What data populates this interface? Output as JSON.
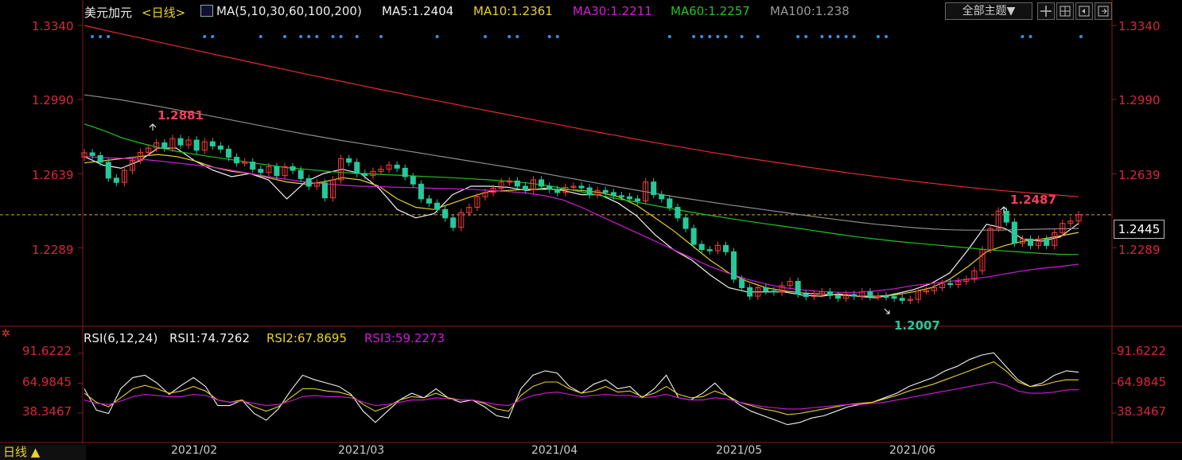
{
  "header": {
    "title": "美元加元",
    "period": "<日线>",
    "ma_label": "MA(5,10,30,60,100,200)",
    "ma5": "MA5:1.2404",
    "ma10": "MA10:1.2361",
    "ma30": "MA30:1.2211",
    "ma60": "MA60:1.2257",
    "ma100": "MA100:1.238",
    "theme_button": "全部主题▼"
  },
  "rsi_header": {
    "label": "RSI(6,12,24)",
    "rsi1": "RSI1:74.7262",
    "rsi2": "RSI2:67.8695",
    "rsi3": "RSI3:59.2273"
  },
  "bottom_bar": {
    "period_button": "日线 ▲"
  },
  "colors": {
    "up": "#ff3b3b",
    "down": "#27c99a",
    "ma5": "#f2f2f2",
    "ma10": "#e8d22a",
    "ma30": "#d21bd8",
    "ma60": "#21c421",
    "ma100": "#8c8c8c",
    "ma200": "#e62b2b",
    "rsi1": "#f2f2f2",
    "rsi2": "#e8d22a",
    "rsi3": "#d21bd8",
    "axis": "#d7263d"
  },
  "chart_data": [
    {
      "type": "candlestick",
      "title": "美元加元",
      "y_ticks": [
        "1.3340",
        "1.2990",
        "1.2639",
        "1.2289"
      ],
      "x_ticks": [
        "2021/02",
        "2021/03",
        "2021/04",
        "2021/05",
        "2021/06"
      ],
      "ylim": [
        1.1925,
        1.334
      ],
      "current_price": "1.2445",
      "annotations": {
        "high": "1.2881",
        "low": "1.2007",
        "recent_high": "1.2487"
      },
      "ohlc_close": [
        1.2738,
        1.2725,
        1.2693,
        1.2618,
        1.2598,
        1.2655,
        1.2702,
        1.274,
        1.276,
        1.2785,
        1.276,
        1.2805,
        1.2775,
        1.2798,
        1.275,
        1.279,
        1.277,
        1.2755,
        1.2717,
        1.269,
        1.2694,
        1.266,
        1.2645,
        1.2672,
        1.263,
        1.2672,
        1.2655,
        1.2616,
        1.258,
        1.2595,
        1.2525,
        1.261,
        1.271,
        1.2693,
        1.264,
        1.263,
        1.265,
        1.266,
        1.268,
        1.2665,
        1.2625,
        1.259,
        1.252,
        1.25,
        1.247,
        1.243,
        1.2385,
        1.2455,
        1.248,
        1.253,
        1.255,
        1.257,
        1.26,
        1.2605,
        1.258,
        1.2563,
        1.261,
        1.258,
        1.2565,
        1.255,
        1.2575,
        1.258,
        1.2572,
        1.254,
        1.256,
        1.255,
        1.2535,
        1.253,
        1.252,
        1.251,
        1.26,
        1.254,
        1.252,
        1.248,
        1.243,
        1.238,
        1.2305,
        1.228,
        1.2275,
        1.23,
        1.227,
        1.214,
        1.21,
        1.206,
        1.21,
        1.2085,
        1.208,
        1.211,
        1.213,
        1.207,
        1.2058,
        1.207,
        1.208,
        1.2063,
        1.205,
        1.2068,
        1.206,
        1.208,
        1.2058,
        1.206,
        1.2058,
        1.205,
        1.204,
        1.2045,
        1.2085,
        1.2086,
        1.21,
        1.212,
        1.2115,
        1.213,
        1.214,
        1.218,
        1.228,
        1.238,
        1.2462,
        1.241,
        1.231,
        1.233,
        1.23,
        1.233,
        1.23,
        1.236,
        1.2404,
        1.2415,
        1.2445
      ],
      "series": [
        {
          "name": "MA5",
          "values": [
            1.272,
            1.268,
            1.2665,
            1.27,
            1.276,
            1.276,
            1.27,
            1.2655,
            1.2625,
            1.264,
            1.261,
            1.252,
            1.26,
            1.264,
            1.266,
            1.264,
            1.257,
            1.247,
            1.243,
            1.245,
            1.254,
            1.258,
            1.258,
            1.2575,
            1.256,
            1.257,
            1.256,
            1.254,
            1.254,
            1.25,
            1.244,
            1.235,
            1.228,
            1.223,
            1.216,
            1.21,
            1.208,
            1.208,
            1.208,
            1.2065,
            1.206,
            1.207,
            1.206,
            1.2052,
            1.207,
            1.209,
            1.212,
            1.217,
            1.228,
            1.24,
            1.238,
            1.233,
            1.232,
            1.234,
            1.2404
          ]
        },
        {
          "name": "MA10",
          "values": [
            1.269,
            1.27,
            1.271,
            1.272,
            1.273,
            1.272,
            1.27,
            1.267,
            1.265,
            1.264,
            1.262,
            1.26,
            1.259,
            1.26,
            1.262,
            1.261,
            1.258,
            1.252,
            1.248,
            1.247,
            1.25,
            1.253,
            1.2555,
            1.256,
            1.2565,
            1.2565,
            1.2565,
            1.256,
            1.255,
            1.253,
            1.249,
            1.243,
            1.237,
            1.23,
            1.223,
            1.217,
            1.213,
            1.21,
            1.2085,
            1.2075,
            1.207,
            1.2065,
            1.206,
            1.206,
            1.2065,
            1.208,
            1.21,
            1.214,
            1.22,
            1.227,
            1.23,
            1.232,
            1.233,
            1.2345,
            1.2361
          ]
        },
        {
          "name": "MA30",
          "values": [
            1.272,
            1.2715,
            1.2712,
            1.2708,
            1.27,
            1.269,
            1.268,
            1.267,
            1.2655,
            1.264,
            1.2625,
            1.2612,
            1.26,
            1.2592,
            1.2585,
            1.258,
            1.2578,
            1.2575,
            1.2573,
            1.257,
            1.2568,
            1.2565,
            1.256,
            1.2555,
            1.2548,
            1.2535,
            1.2515,
            1.248,
            1.244,
            1.24,
            1.236,
            1.232,
            1.228,
            1.224,
            1.22,
            1.2168,
            1.214,
            1.2118,
            1.21,
            1.209,
            1.2082,
            1.2078,
            1.2078,
            1.2085,
            1.2095,
            1.211,
            1.212,
            1.213,
            1.214,
            1.215,
            1.2165,
            1.218,
            1.2192,
            1.22,
            1.2211
          ]
        },
        {
          "name": "MA60",
          "values": [
            1.2874,
            1.2845,
            1.281,
            1.2785,
            1.2764,
            1.2745,
            1.2731,
            1.2718,
            1.2705,
            1.2692,
            1.268,
            1.2668,
            1.266,
            1.2652,
            1.2645,
            1.264,
            1.2636,
            1.2632,
            1.2628,
            1.2624,
            1.262,
            1.2615,
            1.261,
            1.2604,
            1.2596,
            1.2585,
            1.257,
            1.2553,
            1.2536,
            1.252,
            1.2505,
            1.2488,
            1.2472,
            1.2456,
            1.2442,
            1.2428,
            1.2415,
            1.2402,
            1.239,
            1.2378,
            1.2365,
            1.2352,
            1.234,
            1.233,
            1.232,
            1.2312,
            1.2304,
            1.2296,
            1.2288,
            1.228,
            1.2274,
            1.2268,
            1.2262,
            1.2258,
            1.2257
          ]
        },
        {
          "name": "MA100",
          "values": [
            1.3012,
            1.3,
            1.2988,
            1.2973,
            1.2958,
            1.2942,
            1.2926,
            1.291,
            1.2893,
            1.2876,
            1.2859,
            1.2842,
            1.2826,
            1.2811,
            1.2796,
            1.2782,
            1.2768,
            1.2754,
            1.274,
            1.2726,
            1.2712,
            1.2698,
            1.2684,
            1.267,
            1.2656,
            1.264,
            1.2624,
            1.2608,
            1.2592,
            1.2576,
            1.2561,
            1.2546,
            1.2531,
            1.2518,
            1.2505,
            1.2492,
            1.248,
            1.2468,
            1.2456,
            1.2444,
            1.2432,
            1.2421,
            1.241,
            1.24,
            1.2392,
            1.2384,
            1.2378,
            1.2374,
            1.2372,
            1.2372,
            1.2373,
            1.2375,
            1.2377,
            1.2379,
            1.238
          ]
        },
        {
          "name": "MA200",
          "values": [
            1.334,
            1.332,
            1.33,
            1.3282,
            1.3262,
            1.3243,
            1.3224,
            1.3204,
            1.3186,
            1.3167,
            1.3148,
            1.313,
            1.3111,
            1.3093,
            1.3075,
            1.3057,
            1.3039,
            1.3022,
            1.3004,
            1.2987,
            1.297,
            1.2952,
            1.2935,
            1.2918,
            1.2901,
            1.2884,
            1.2867,
            1.285,
            1.2834,
            1.2818,
            1.2802,
            1.2786,
            1.2771,
            1.2756,
            1.2741,
            1.2727,
            1.2713,
            1.27,
            1.2687,
            1.2674,
            1.2661,
            1.2649,
            1.2637,
            1.2626,
            1.2615,
            1.2604,
            1.2594,
            1.2584,
            1.2575,
            1.2566,
            1.2558,
            1.2551,
            1.2544,
            1.2537,
            1.253
          ]
        }
      ]
    },
    {
      "type": "line",
      "title": "RSI(6,12,24)",
      "y_ticks": [
        "91.6222",
        "64.9845",
        "38.3467"
      ],
      "ylim": [
        15,
        100
      ],
      "series": [
        {
          "name": "RSI1",
          "values": [
            60,
            41,
            38,
            60,
            70,
            72,
            65,
            55,
            63,
            70,
            62,
            45,
            45,
            50,
            38,
            32,
            42,
            58,
            72,
            68,
            65,
            62,
            55,
            40,
            30,
            40,
            50,
            56,
            52,
            60,
            52,
            48,
            50,
            44,
            36,
            34,
            60,
            72,
            76,
            74,
            62,
            56,
            64,
            68,
            60,
            62,
            52,
            60,
            72,
            52,
            50,
            56,
            65,
            54,
            46,
            40,
            36,
            32,
            28,
            30,
            34,
            36,
            40,
            44,
            46,
            48,
            52,
            56,
            62,
            66,
            70,
            76,
            80,
            86,
            90,
            92,
            80,
            68,
            62,
            65,
            72,
            76,
            74.7
          ]
        },
        {
          "name": "RSI2",
          "values": [
            56,
            48,
            44,
            52,
            60,
            63,
            60,
            56,
            58,
            62,
            58,
            50,
            48,
            50,
            44,
            40,
            44,
            52,
            60,
            60,
            58,
            57,
            54,
            46,
            40,
            44,
            50,
            53,
            52,
            56,
            52,
            50,
            50,
            47,
            42,
            40,
            54,
            62,
            66,
            66,
            60,
            56,
            58,
            62,
            57,
            58,
            53,
            56,
            62,
            55,
            52,
            53,
            58,
            54,
            48,
            45,
            42,
            40,
            37,
            38,
            40,
            42,
            44,
            46,
            47,
            48,
            51,
            54,
            58,
            61,
            64,
            68,
            72,
            76,
            80,
            84,
            76,
            66,
            62,
            63,
            66,
            68,
            67.9
          ]
        },
        {
          "name": "RSI3",
          "values": [
            50,
            47,
            46,
            49,
            53,
            55,
            54,
            53,
            53,
            55,
            54,
            50,
            48,
            49,
            47,
            45,
            46,
            49,
            53,
            54,
            53,
            53,
            52,
            48,
            45,
            46,
            48,
            50,
            50,
            52,
            51,
            50,
            50,
            48,
            46,
            45,
            50,
            54,
            56,
            57,
            55,
            53,
            54,
            55,
            54,
            54,
            52,
            53,
            55,
            52,
            50,
            50,
            52,
            51,
            48,
            46,
            44,
            43,
            42,
            42,
            43,
            44,
            45,
            46,
            46,
            47,
            48,
            50,
            52,
            54,
            56,
            58,
            60,
            62,
            64,
            66,
            63,
            58,
            56,
            56,
            57,
            59,
            59.2
          ]
        }
      ]
    }
  ]
}
